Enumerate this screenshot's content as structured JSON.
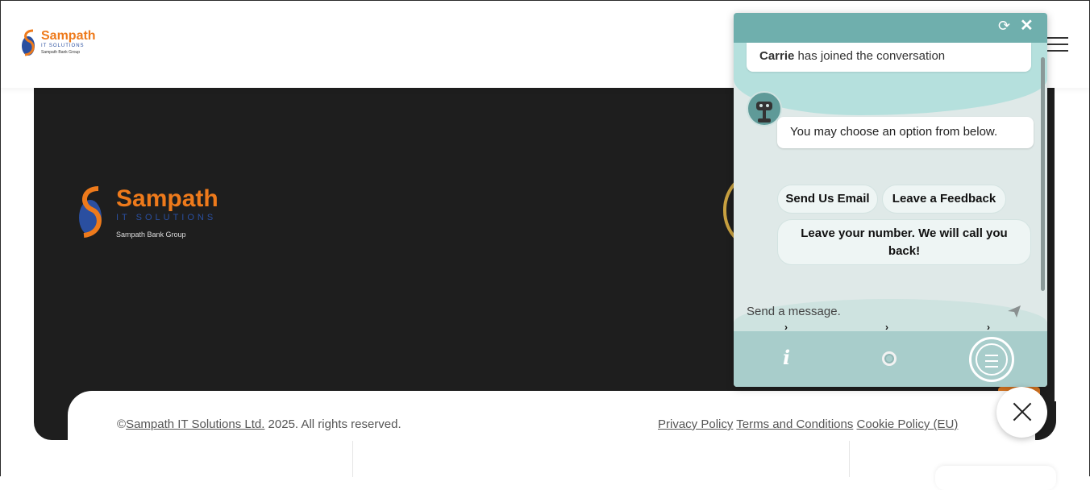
{
  "header": {
    "logo": {
      "name": "Sampath",
      "sub": "IT SOLUTIONS",
      "group": "Sampath Bank Group"
    }
  },
  "footer": {
    "logo": {
      "name": "Sampath",
      "sub": "IT SOLUTIONS",
      "group": "Sampath Bank Group"
    },
    "copyright_symbol": "©",
    "company_link": "Sampath IT Solutions Ltd.",
    "rights": " 2025. All rights reserved.",
    "links": [
      "Privacy Policy",
      "Terms and Conditions",
      "Cookie Policy (EU)"
    ]
  },
  "chat": {
    "joined_name": "Carrie",
    "joined_text": " has joined the conversation",
    "bot_message": "You may choose an option from below.",
    "options": [
      "Send Us Email",
      "Leave a Feedback",
      "Leave your number. We will call you back!"
    ],
    "input_placeholder": "Send a message.",
    "info_glyph": "i",
    "colors": {
      "header": "#6fafad",
      "footer": "#a8cdcb",
      "body": "#dfe9e8"
    }
  },
  "colors": {
    "brand_orange": "#ee7a1b",
    "brand_blue": "#2a4fa0",
    "footer_dark": "#1e1e1e"
  },
  "icons": [
    "hamburger-icon",
    "refresh-icon",
    "close-icon",
    "send-icon",
    "info-icon",
    "circle-icon",
    "menu-icon",
    "close-fab-icon"
  ]
}
